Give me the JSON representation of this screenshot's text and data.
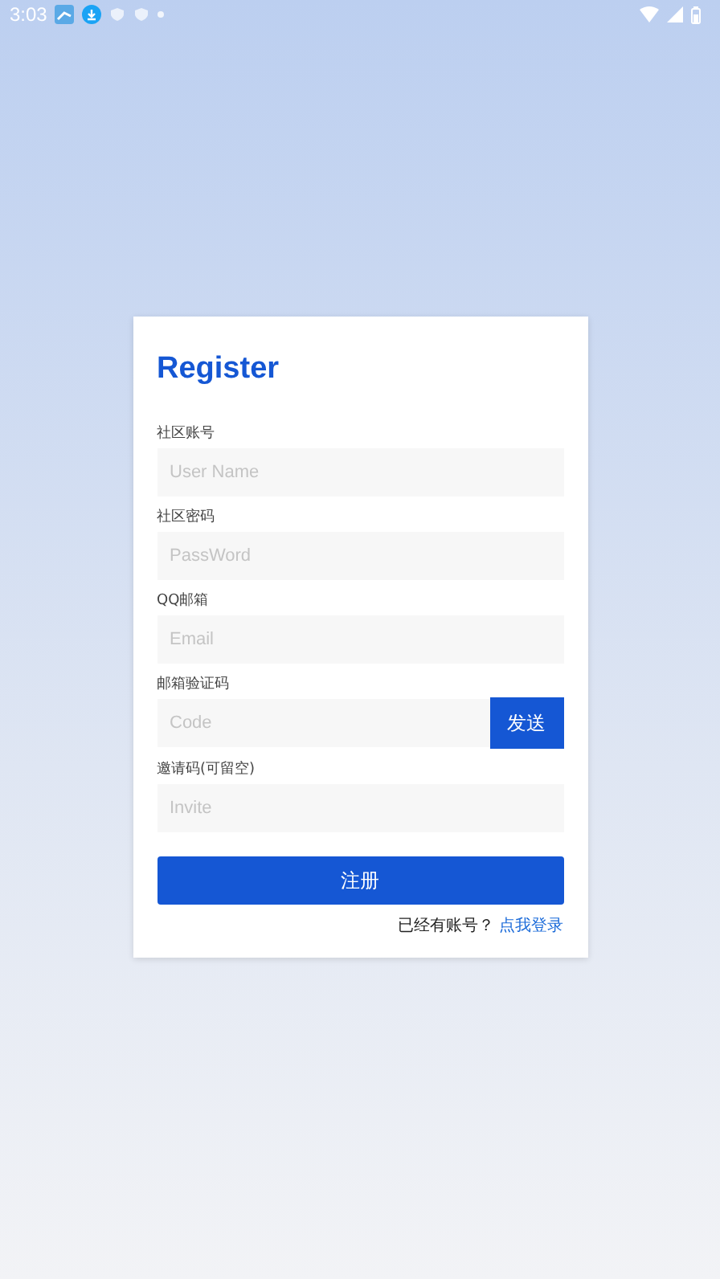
{
  "status_bar": {
    "time": "3:03"
  },
  "form": {
    "title": "Register",
    "fields": [
      {
        "kind": "input",
        "label": "社区账号",
        "placeholder": "User Name"
      },
      {
        "kind": "input",
        "label": "社区密码",
        "placeholder": "PassWord"
      },
      {
        "kind": "input",
        "label": "QQ邮箱",
        "placeholder": "Email"
      },
      {
        "kind": "code",
        "label": "邮箱验证码",
        "placeholder": "Code",
        "button": "发送"
      },
      {
        "kind": "input",
        "label": "邀请码(可留空)",
        "placeholder": "Invite"
      }
    ],
    "submit": "注册",
    "footer_text": "已经有账号？",
    "login_link": "点我登录"
  }
}
